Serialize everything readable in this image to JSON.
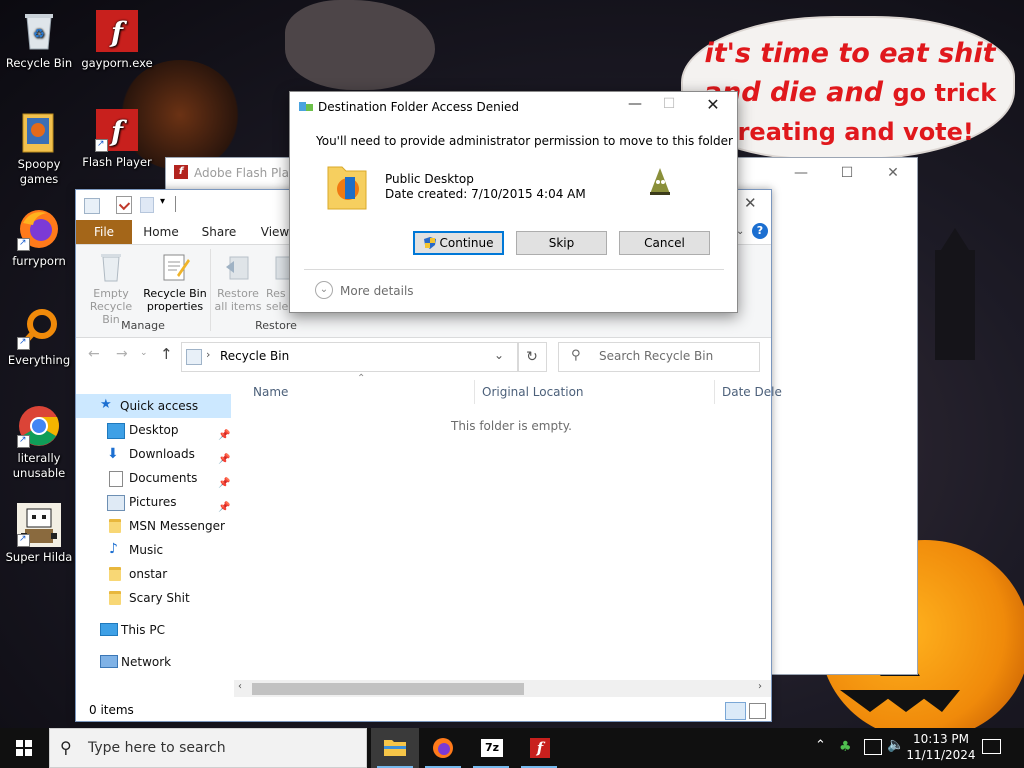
{
  "wallpaper": {
    "bubble_lines": [
      "it's time to eat shit",
      "and die and",
      "go trick",
      "treating and vote!"
    ],
    "colors": {
      "bubble_text": "#e0181c",
      "pumpkin": "#f08a0a"
    }
  },
  "desktop_icons": [
    {
      "label": "Recycle Bin",
      "icon": "recycle-bin-icon"
    },
    {
      "label": "gayporn.exe",
      "icon": "flash-icon"
    },
    {
      "label": "Spoopy games",
      "icon": "games-folder-icon"
    },
    {
      "label": "Flash Player",
      "icon": "flash-icon"
    },
    {
      "label": "furryporn",
      "icon": "firefox-icon"
    },
    {
      "label": "Everything",
      "icon": "everything-search-icon"
    },
    {
      "label": "literally unusable",
      "icon": "chrome-icon"
    },
    {
      "label": "Super Hilda",
      "icon": "pixel-game-icon"
    }
  ],
  "background_window": {
    "title": "Adobe Flash Playe"
  },
  "explorer": {
    "tabs": {
      "file": "File",
      "home": "Home",
      "share": "Share",
      "view": "View"
    },
    "ribbon": {
      "empty_recycle_bin": "Empty Recycle Bin",
      "empty_line1": "Empty",
      "empty_line2": "Recycle Bin",
      "properties_line1": "Recycle Bin",
      "properties_line2": "properties",
      "restore_all_line1": "Restore",
      "restore_all_line2": "all items",
      "restore_sel_line1": "Res",
      "restore_sel_line2": "selec",
      "group_manage": "Manage",
      "group_restore": "Restore"
    },
    "address": {
      "path": "Recycle Bin",
      "search_placeholder": "Search Recycle Bin"
    },
    "nav": {
      "quick_access": "Quick access",
      "items": [
        {
          "label": "Desktop",
          "pinned": true
        },
        {
          "label": "Downloads",
          "pinned": true
        },
        {
          "label": "Documents",
          "pinned": true
        },
        {
          "label": "Pictures",
          "pinned": true
        },
        {
          "label": "MSN Messenger",
          "pinned": false
        },
        {
          "label": "Music",
          "pinned": false
        },
        {
          "label": "onstar",
          "pinned": false
        },
        {
          "label": "Scary Shit",
          "pinned": false
        }
      ],
      "this_pc": "This PC",
      "network": "Network"
    },
    "columns": {
      "name": "Name",
      "original_location": "Original Location",
      "date_deleted": "Date Dele"
    },
    "empty_message": "This folder is empty.",
    "status": "0 items"
  },
  "dialog": {
    "title": "Destination Folder Access Denied",
    "message": "You'll need to provide administrator permission to move to this folder",
    "item_name": "Public Desktop",
    "item_date": "Date created: 7/10/2015 4:04 AM",
    "continue": "Continue",
    "skip": "Skip",
    "cancel": "Cancel",
    "more_details": "More details"
  },
  "taskbar": {
    "search_placeholder": "Type here to search",
    "time": "10:13 PM",
    "date": "11/11/2024",
    "apps": [
      "file-explorer-icon",
      "firefox-icon",
      "7zip-icon",
      "flash-icon"
    ]
  }
}
